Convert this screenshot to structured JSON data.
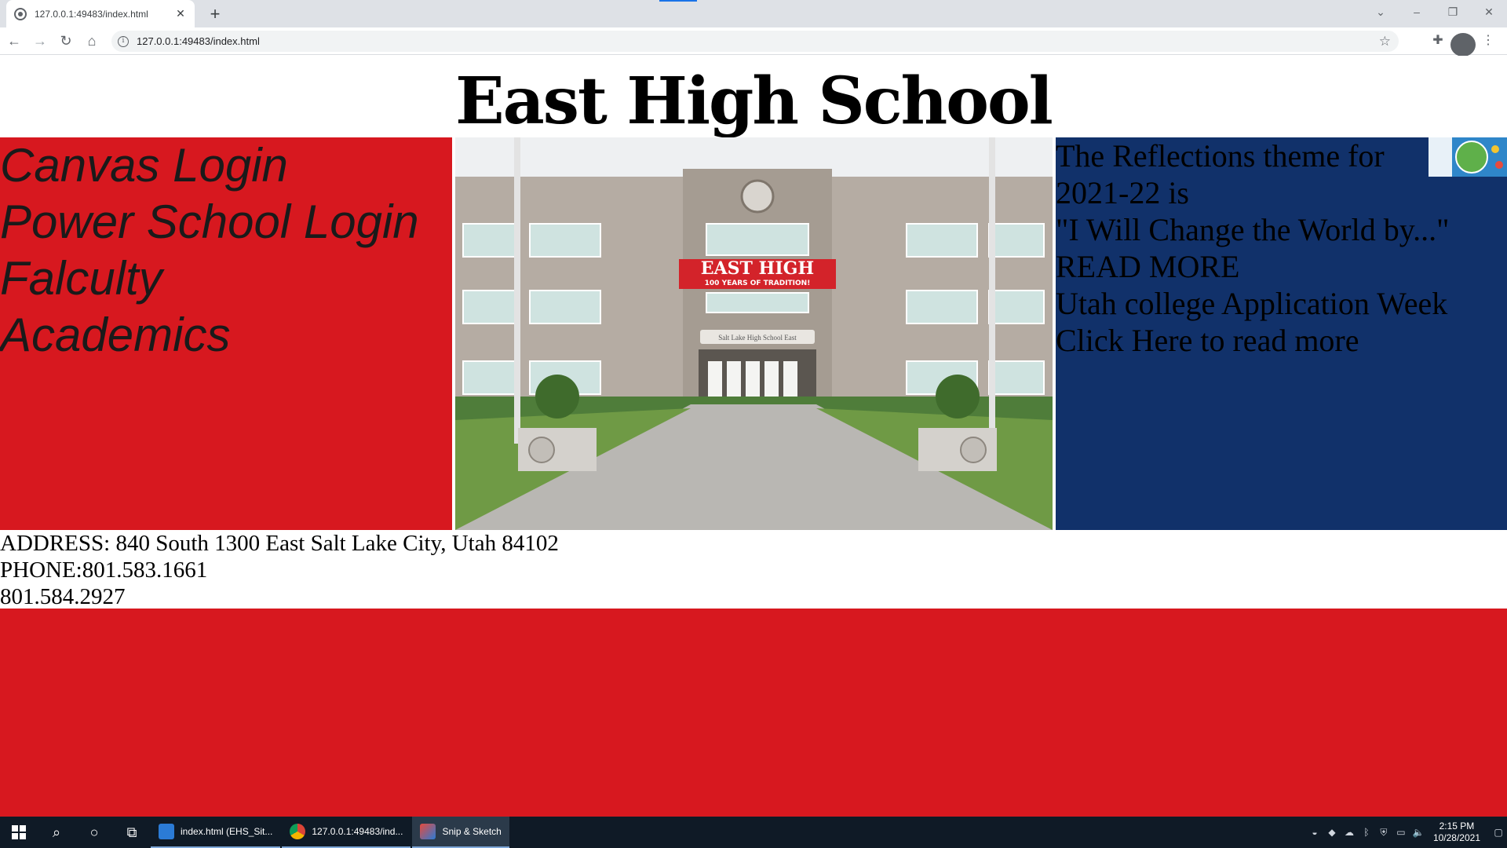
{
  "browser": {
    "tab_title": "127.0.0.1:49483/index.html",
    "tab_close": "✕",
    "new_tab": "+",
    "url": "127.0.0.1:49483/index.html",
    "window_controls": {
      "list": "⌄",
      "minimize": "–",
      "restore": "❐",
      "close": "✕"
    }
  },
  "page": {
    "title": "East High School",
    "nav_links": [
      "Canvas Login",
      "Power School Login",
      "Falculty",
      "Academics"
    ],
    "news": {
      "theme_text": "The Reflections theme for 2021-22 is",
      "quote": "\"I Will Change the World by...\"",
      "read_more": "READ MORE",
      "week_title": "Utah college Application Week",
      "click_here": "Click Here to read more"
    },
    "contact": {
      "address": "ADDRESS: 840 South 1300 East Salt Lake City, Utah 84102",
      "phone": "PHONE:801.583.1661",
      "phone2": "801.584.2927"
    },
    "banner_text": "EAST HIGH",
    "banner_subtext": "100 YEARS OF TRADITION!",
    "sign_text": "Salt Lake High School East"
  },
  "taskbar": {
    "tasks": [
      {
        "label": "index.html (EHS_Sit...",
        "icon": "editor-icon"
      },
      {
        "label": "127.0.0.1:49483/ind...",
        "icon": "chrome-icon"
      },
      {
        "label": "Snip & Sketch",
        "icon": "snip-sketch-icon"
      }
    ],
    "time": "2:15 PM",
    "date": "10/28/2021"
  },
  "colors": {
    "red": "#d7181f",
    "navy": "#11316a",
    "taskbar": "#0f1a26"
  }
}
